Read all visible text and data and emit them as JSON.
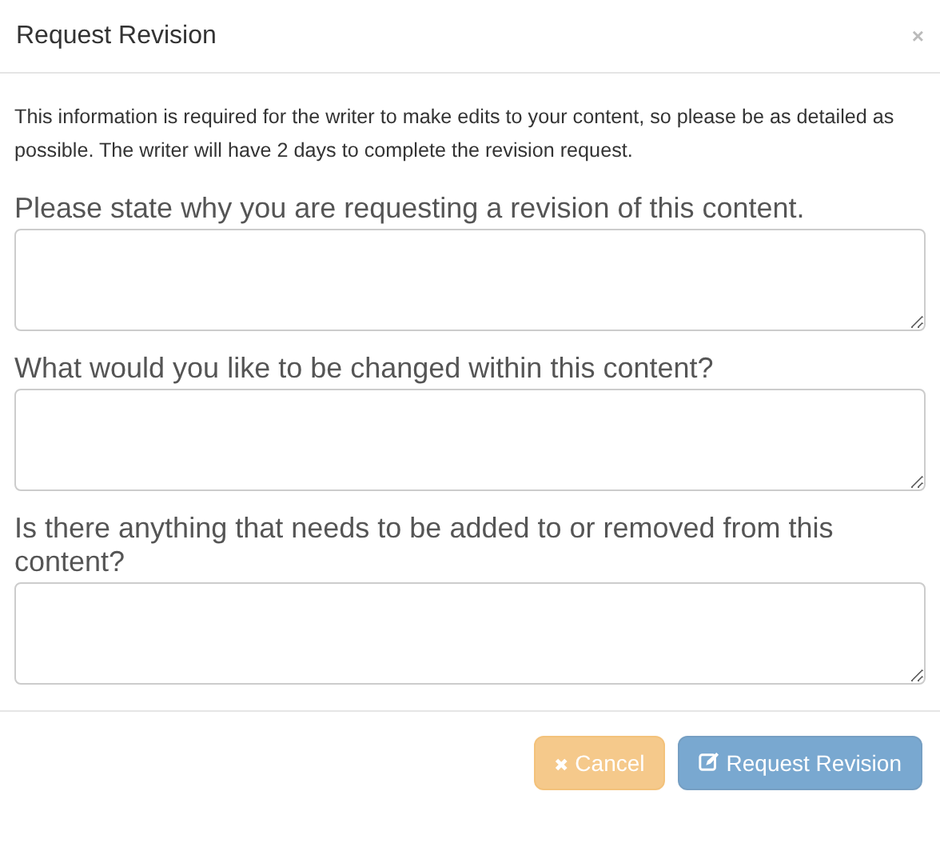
{
  "dialog": {
    "title": "Request Revision",
    "close": "×"
  },
  "intro": "This information is required for the writer to make edits to your content, so please be as detailed as possible. The writer will have 2 days to complete the revision request.",
  "questions": [
    {
      "label": "Please state why you are requesting a revision of this content."
    },
    {
      "label": "What would you like to be changed within this content?"
    },
    {
      "label": "Is there anything that needs to be added to or removed from this content?"
    }
  ],
  "buttons": [
    {
      "kind": "cancel",
      "icon": "✖",
      "label": "Cancel",
      "disabled": true
    },
    {
      "kind": "submit",
      "label": "Request Revision",
      "disabled": true
    }
  ]
}
